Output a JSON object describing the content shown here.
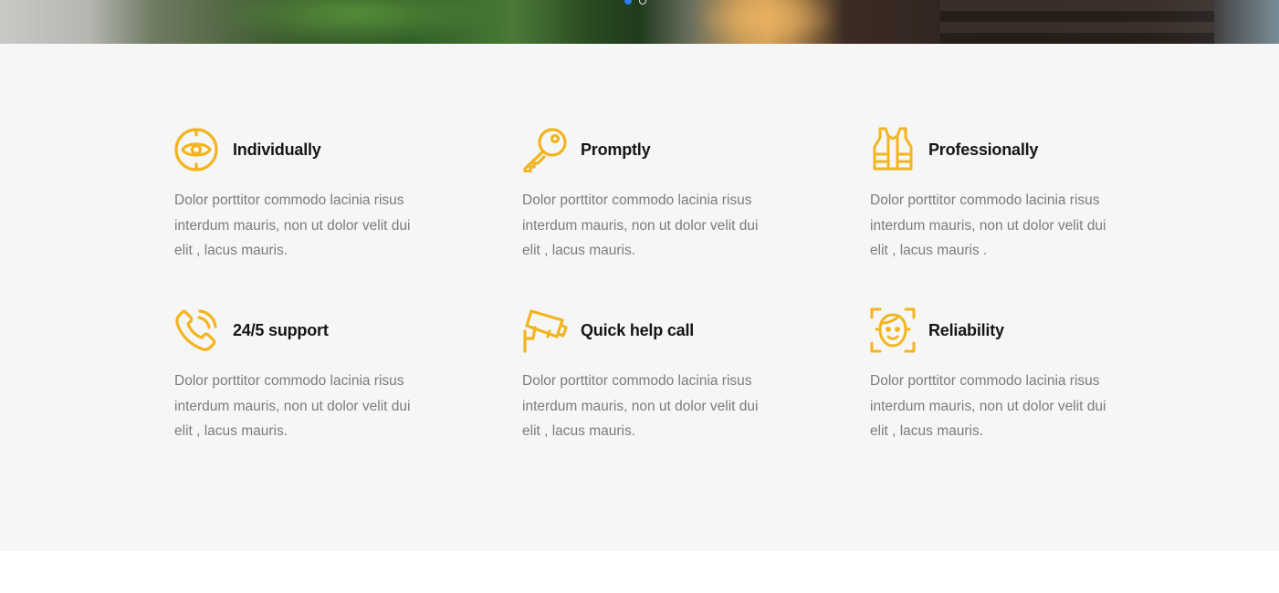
{
  "colors": {
    "accent": "#F2B51F",
    "section_background": "#F6F6F6",
    "heading": "#151515",
    "body_text": "#7C7C7C",
    "slider_dot_active": "#2E7CF6"
  },
  "hero": {
    "slider_dots": [
      {
        "state": "active"
      },
      {
        "state": "inactive"
      }
    ]
  },
  "features": [
    {
      "icon": "target-disc-icon",
      "title": "Individually",
      "text": "Dolor porttitor commodo lacinia risus interdum mauris, non ut dolor velit dui elit , lacus mauris."
    },
    {
      "icon": "key-icon",
      "title": "Promptly",
      "text": "Dolor porttitor commodo lacinia risus interdum mauris, non ut dolor velit dui elit , lacus mauris."
    },
    {
      "icon": "safety-vest-icon",
      "title": "Professionally",
      "text": "Dolor porttitor commodo lacinia risus interdum mauris, non ut dolor velit dui elit , lacus mauris ."
    },
    {
      "icon": "phone-icon",
      "title": "24/5 support",
      "text": "Dolor porttitor commodo lacinia risus interdum mauris, non ut dolor velit dui elit , lacus mauris."
    },
    {
      "icon": "security-camera-icon",
      "title": "Quick help call",
      "text": "Dolor porttitor commodo lacinia risus interdum mauris, non ut dolor velit dui elit , lacus mauris."
    },
    {
      "icon": "face-scan-icon",
      "title": "Reliability",
      "text": "Dolor porttitor commodo lacinia risus interdum mauris, non ut dolor velit dui elit , lacus mauris."
    }
  ]
}
